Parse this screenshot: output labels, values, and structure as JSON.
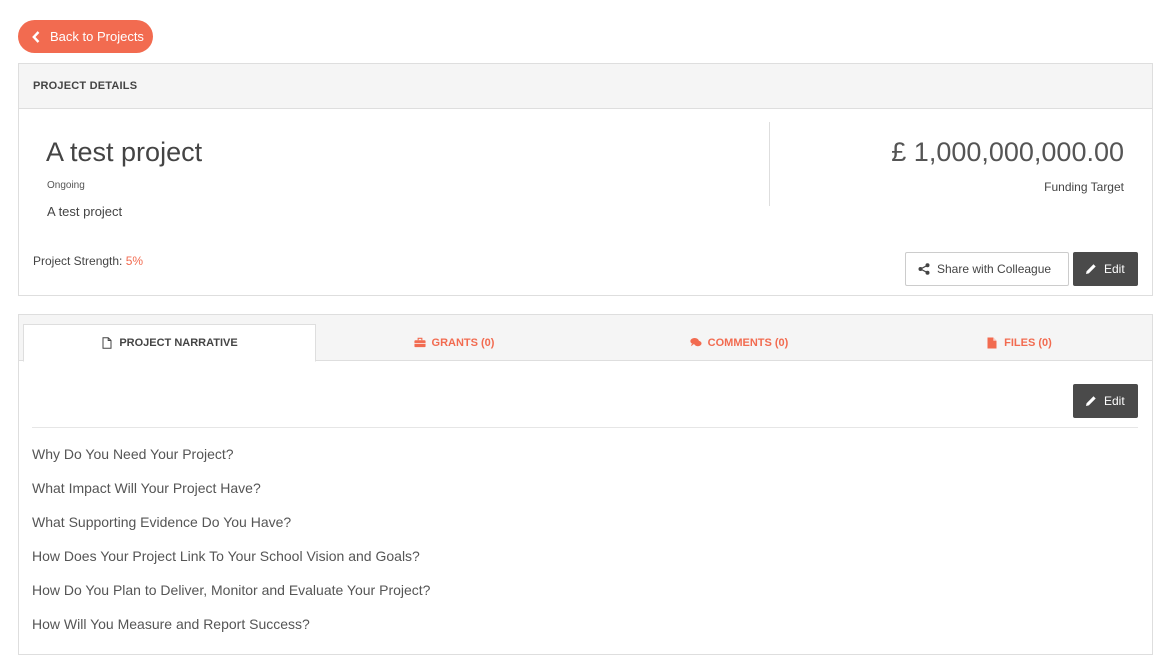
{
  "back_button": {
    "label": "Back to Projects"
  },
  "details_panel": {
    "header": "PROJECT DETAILS",
    "title": "A test project",
    "status": "Ongoing",
    "description": "A test project",
    "funding_amount": "£ 1,000,000,000.00",
    "funding_label": "Funding Target",
    "strength_label": "Project Strength:",
    "strength_value": "5%",
    "share_label": "Share with Colleague",
    "edit_label": "Edit"
  },
  "narrative_panel": {
    "tabs": [
      {
        "label": "PROJECT NARRATIVE",
        "icon": "file-icon"
      },
      {
        "label": "GRANTS (0)",
        "icon": "briefcase-icon"
      },
      {
        "label": "COMMENTS (0)",
        "icon": "comments-icon"
      },
      {
        "label": "FILES (0)",
        "icon": "file-solid-icon"
      }
    ],
    "edit_label": "Edit",
    "questions": [
      "Why Do You Need Your Project?",
      "What Impact Will Your Project Have?",
      "What Supporting Evidence Do You Have?",
      "How Does Your Project Link To Your School Vision and Goals?",
      "How Do You Plan to Deliver, Monitor and Evaluate Your Project?",
      "How Will You Measure and Report Success?"
    ]
  },
  "colors": {
    "accent": "#f26b50",
    "dark_button": "#4a4a4a",
    "panel_header_bg": "#f5f5f5"
  }
}
